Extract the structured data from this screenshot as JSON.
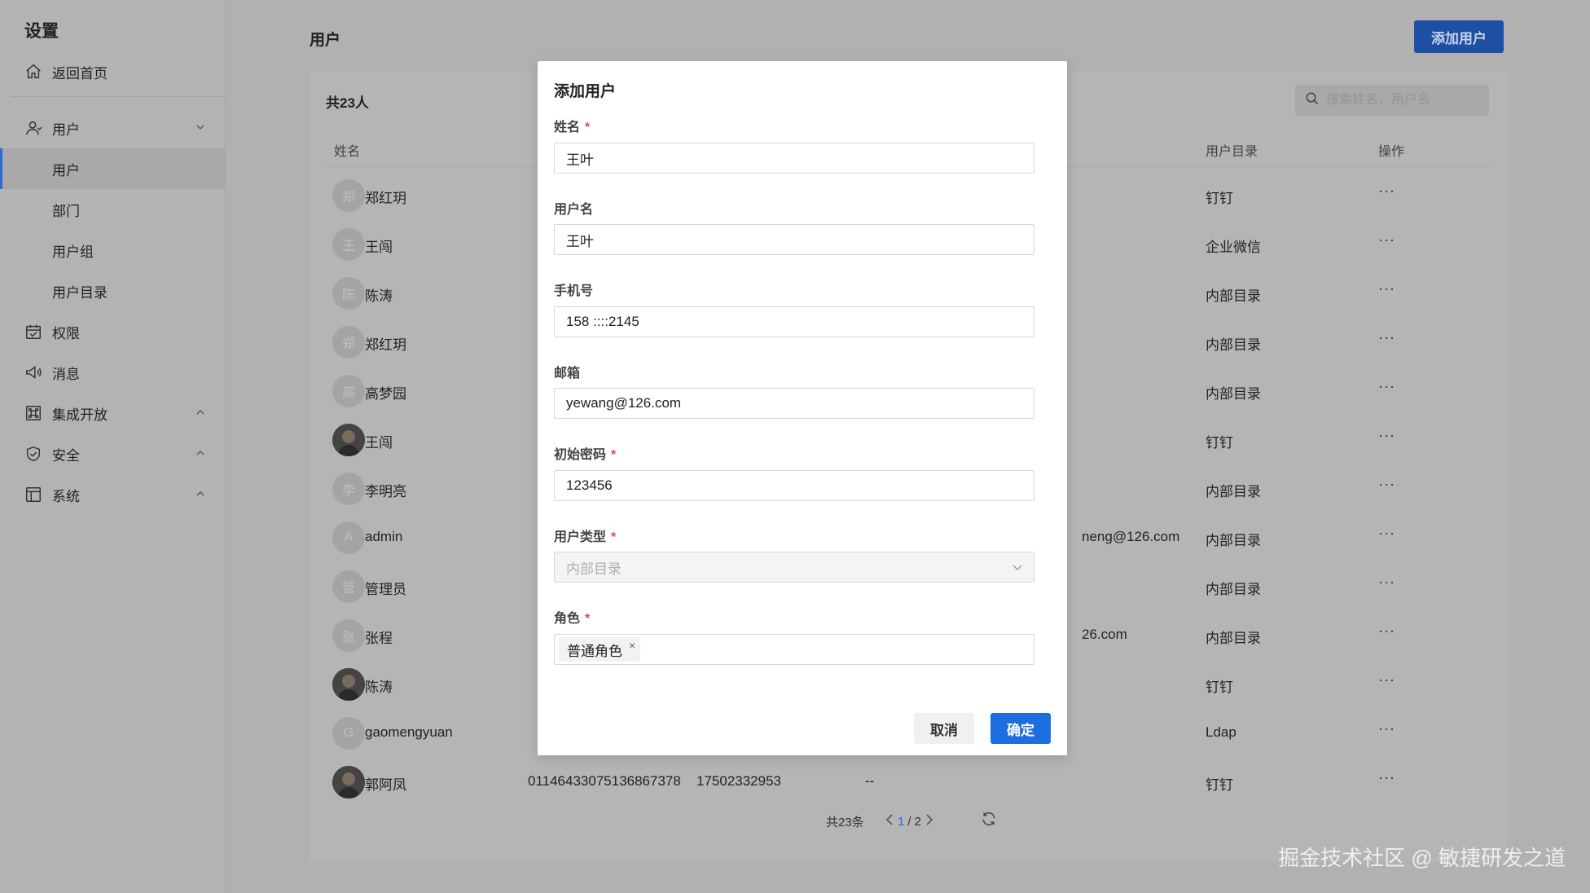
{
  "sidebar": {
    "title": "设置",
    "home_label": "返回首页",
    "users_label": "用户",
    "sub_items": [
      "用户",
      "部门",
      "用户组",
      "用户目录"
    ],
    "items": [
      {
        "label": "权限",
        "icon": "calendar-check-icon"
      },
      {
        "label": "消息",
        "icon": "megaphone-icon"
      },
      {
        "label": "集成开放",
        "icon": "command-icon"
      },
      {
        "label": "安全",
        "icon": "shield-icon"
      },
      {
        "label": "系统",
        "icon": "layout-icon"
      }
    ]
  },
  "header": {
    "title": "用户",
    "add_button": "添加用户"
  },
  "list": {
    "count": "共23人",
    "search_placeholder": "搜索姓名、用户名",
    "columns": {
      "name": "姓名",
      "directory": "用户目录",
      "actions": "操作"
    },
    "ops_symbol": "···",
    "rows": [
      {
        "avatar": "郑",
        "name": "郑红玥",
        "directory": "钉钉",
        "extra": ""
      },
      {
        "avatar": "王",
        "name": "王闯",
        "directory": "企业微信",
        "extra": ""
      },
      {
        "avatar": "陈",
        "name": "陈涛",
        "directory": "内部目录",
        "extra": ""
      },
      {
        "avatar": "郑",
        "name": "郑红玥",
        "directory": "内部目录",
        "extra": ""
      },
      {
        "avatar": "高",
        "name": "高梦园",
        "directory": "内部目录",
        "extra": ""
      },
      {
        "avatar": "",
        "name": "王闯",
        "directory": "钉钉",
        "extra": "",
        "photo": true
      },
      {
        "avatar": "李",
        "name": "李明亮",
        "directory": "内部目录",
        "extra": ""
      },
      {
        "avatar": "A",
        "name": "admin",
        "directory": "内部目录",
        "extra": "neng@126.com"
      },
      {
        "avatar": "管",
        "name": "管理员",
        "directory": "内部目录",
        "extra": ""
      },
      {
        "avatar": "张",
        "name": "张程",
        "directory": "内部目录",
        "extra": "26.com"
      },
      {
        "avatar": "",
        "name": "陈涛",
        "directory": "钉钉",
        "extra": "",
        "photo": true
      },
      {
        "avatar": "G",
        "name": "gaomengyuan",
        "directory": "Ldap",
        "extra": ""
      },
      {
        "avatar": "",
        "name": "郭阿凤",
        "directory": "钉钉",
        "extra": "--",
        "photo": true,
        "id": "01146433075136867378",
        "phone": "17502332953"
      }
    ],
    "pager": {
      "total": "共23条",
      "current": "1",
      "separator": "/",
      "pages": "2"
    }
  },
  "modal": {
    "title": "添加用户",
    "fields": {
      "name": {
        "label": "姓名",
        "value": "王叶",
        "required": "*"
      },
      "username": {
        "label": "用户名",
        "value": "王叶"
      },
      "phone": {
        "label": "手机号",
        "value": "158 ::::2145"
      },
      "email": {
        "label": "邮箱",
        "value": "yewang@126.com"
      },
      "password": {
        "label": "初始密码",
        "value": "123456",
        "required": "*"
      },
      "user_type": {
        "label": "用户类型",
        "value": "内部目录",
        "required": "*"
      },
      "role": {
        "label": "角色",
        "tag": "普通角色",
        "tag_close": "×",
        "required": "*"
      }
    },
    "cancel": "取消",
    "confirm": "确定"
  },
  "watermark": "掘金技术社区 @ 敏捷研发之道",
  "colors": {
    "primary": "#1d6fe0",
    "add_button_bg": "#1d4fa3",
    "required": "#e5484d",
    "overlay": "#b1b1b1"
  }
}
